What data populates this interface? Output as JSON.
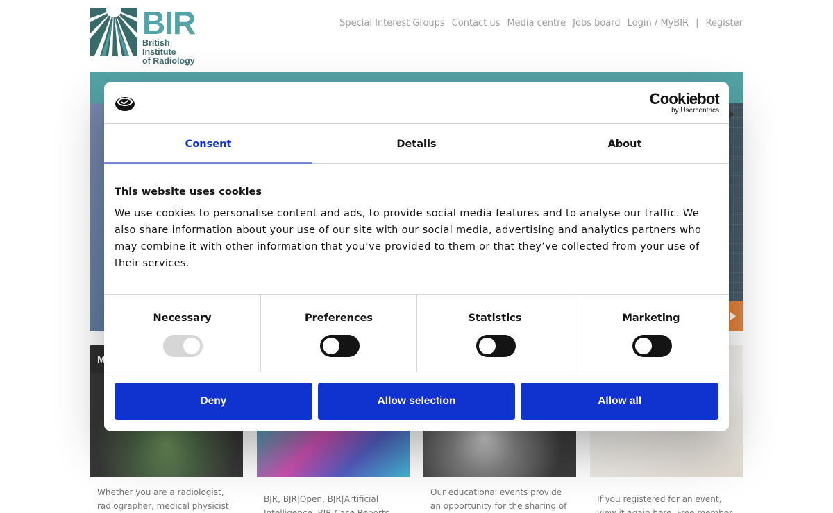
{
  "site": {
    "logo": {
      "big": "BIR",
      "line1": "British Institute",
      "line2": "of Radiology"
    },
    "nav": [
      "Special Interest Groups",
      "Contact us",
      "Media centre",
      "Jobs board",
      "Login / MyBIR"
    ],
    "nav_separator": "|",
    "register": "Register"
  },
  "cards": [
    {
      "heading": "M",
      "text_lines": [
        "Whether you are a radiologist,",
        "radiographer, medical physicist,"
      ]
    },
    {
      "heading": "",
      "text_lines": [
        "BJR, BJR|Open, BJR|Artificial",
        "Intelligence, BJR|Case Reports"
      ]
    },
    {
      "heading": "",
      "text_lines": [
        "Our educational events provide",
        "an opportunity for the sharing of"
      ]
    },
    {
      "heading": "",
      "text_lines": [
        "If you registered for an event,",
        "view it again here. Free member-"
      ]
    }
  ],
  "dialog": {
    "brand": {
      "name": "Cookiebot",
      "by": "by Usercentrics"
    },
    "tabs": [
      {
        "label": "Consent",
        "active": true
      },
      {
        "label": "Details",
        "active": false
      },
      {
        "label": "About",
        "active": false
      }
    ],
    "title": "This website uses cookies",
    "text": "We use cookies to personalise content and ads, to provide social media features and to analyse our traffic. We also share information about your use of our site with our social media, advertising and analytics partners who may combine it with other information that you’ve provided to them or that they’ve collected from your use of their services.",
    "categories": [
      {
        "label": "Necessary",
        "checked": true,
        "disabled": true
      },
      {
        "label": "Preferences",
        "checked": false,
        "disabled": false
      },
      {
        "label": "Statistics",
        "checked": false,
        "disabled": false
      },
      {
        "label": "Marketing",
        "checked": false,
        "disabled": false
      }
    ],
    "buttons": {
      "deny": "Deny",
      "allow_selection": "Allow selection",
      "allow_all": "Allow all"
    }
  },
  "colors": {
    "accent": "#1032cf",
    "text": "#141414",
    "teal": "#2f8f94",
    "nav_text": "#8a8a8a",
    "orange": "#e06a12"
  },
  "icons": [
    "cookiebot-logo-icon",
    "bir-logo-mark"
  ]
}
